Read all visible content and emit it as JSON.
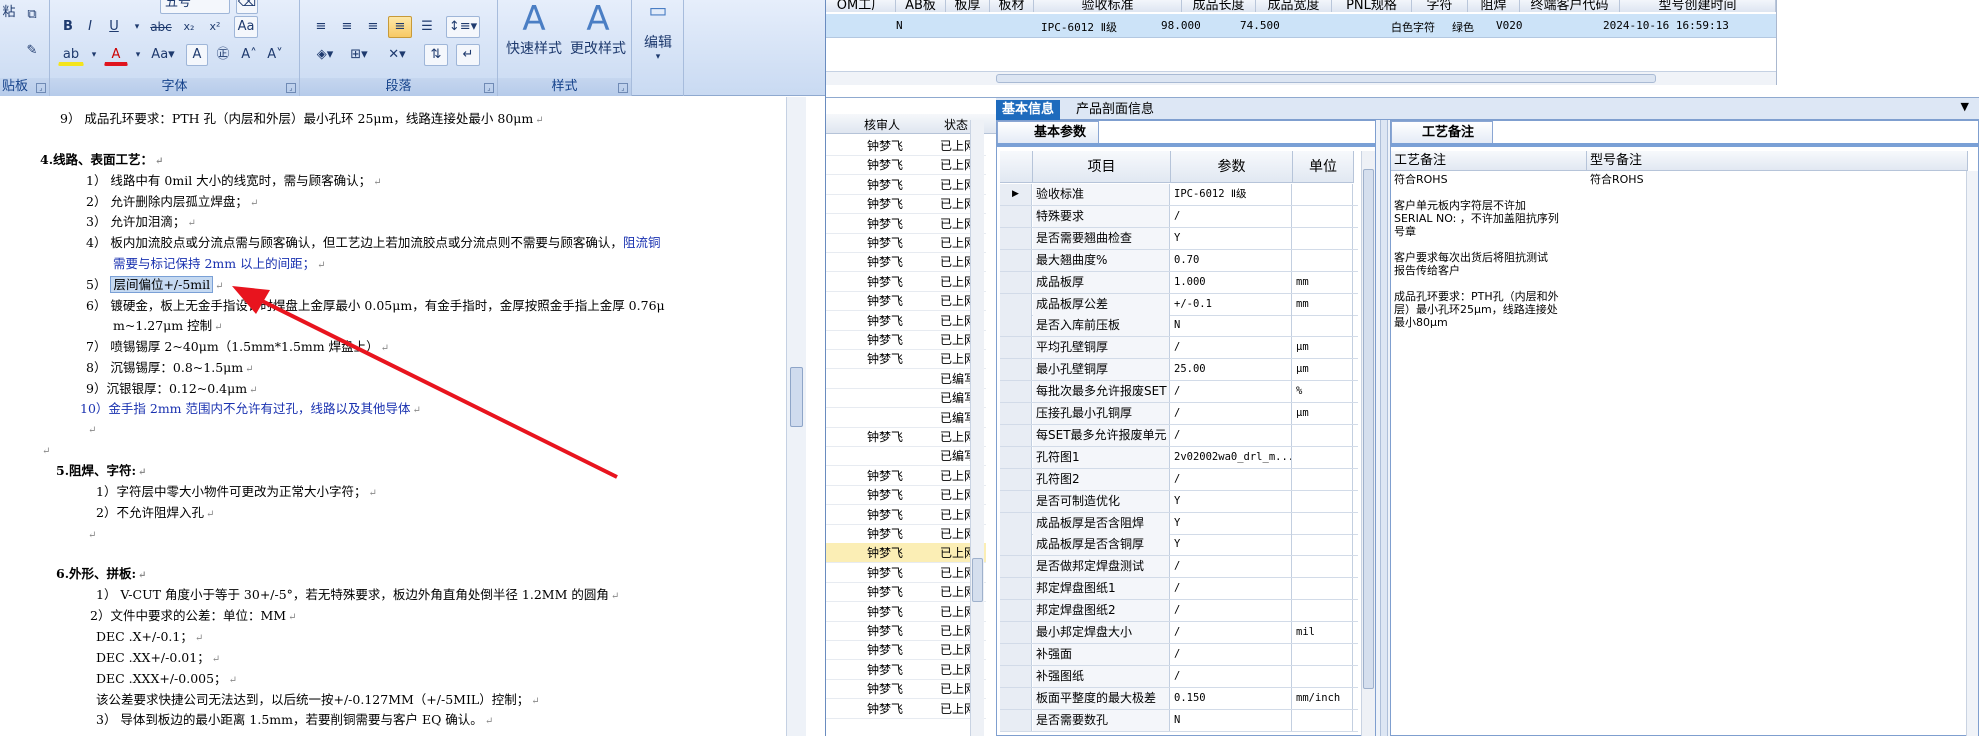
{
  "word": {
    "ribbon": {
      "font_group_label": "字体",
      "paragraph_group_label": "段落",
      "styles_group_label": "样式",
      "clipboard_label": "粘",
      "clipboard_group_label": "贴板",
      "font_size_value": "五号",
      "quick_styles_label": "快速样式",
      "change_styles_label": "更改样式",
      "edit_label": "编辑"
    },
    "lines": [
      "9） 成品孔环要求：PTH 孔（内层和外层）最小孔环 25μm，线路连接处最小 80μm",
      "4.线路、表面工艺：",
      "1） 线路中有 0mil 大小的线宽时，需与顾客确认；",
      "2） 允许删除内层孤立焊盘；",
      "3） 允许加泪滴；",
      "4） 板内加流胶点或分流点需与顾客确认，但工艺边上若加流胶点或分流点则不需要与顾客确认，",
      "阻流铜",
      "需要与标记保持 2mm 以上的间距；",
      "5）",
      "层间偏位+/-5mil",
      "6） 镀硬金，板上无金手指设计时焊盘上金厚最小 0.05μm，有金手指时，金厚按照金手指上金厚 0.76μ",
      "m~1.27μm 控制",
      "7） 喷锡锡厚 2~40μm（1.5mm*1.5mm 焊盘上）",
      "8） 沉锡锡厚：0.8~1.5μm",
      "9）沉银银厚：0.12~0.4μm",
      "10）金手指 2mm 范围内不允许有过孔，线路以及其他导体",
      "5.阻焊、字符:",
      "1）字符层中零大小物件可更改为正常大小字符；",
      "2）不允许阻焊入孔",
      "6.外形、拼板:",
      "1） V-CUT 角度小于等于 30+/-5°，若无特殊要求，板边外角直角处倒半径 1.2MM 的圆角",
      "2）文件中要求的公差：单位：MM",
      "DEC .X+/-0.1；",
      "DEC .XX+/-0.01；",
      "DEC .XXX+/-0.005；",
      "该公差要求快捷公司无法达到，以后统一按+/-0.127MM（+/-5MIL）控制；",
      "3） 导体到板边的最小距离 1.5mm，若要削铜需要与客户 EQ 确认。"
    ]
  },
  "topgrid": {
    "headers": [
      "OM工厂",
      "AB板",
      "板厚",
      "板材",
      "验收标准",
      "成品长度",
      "成品宽度",
      "PNL规格",
      "字符",
      "阻焊",
      "终端客户代码",
      "型号创建时间"
    ],
    "row": [
      "N",
      "IPC-6012 Ⅱ级",
      "98.000",
      "74.500",
      "白色字符",
      "绿色",
      "V020",
      "2024-10-16 16:59:13"
    ]
  },
  "midlist": {
    "headers": [
      "核审人",
      "状态"
    ],
    "rows": [
      [
        "钟梦飞",
        "已上网"
      ],
      [
        "钟梦飞",
        "已上网"
      ],
      [
        "钟梦飞",
        "已上网"
      ],
      [
        "钟梦飞",
        "已上网"
      ],
      [
        "钟梦飞",
        "已上网"
      ],
      [
        "钟梦飞",
        "已上网"
      ],
      [
        "钟梦飞",
        "已上网"
      ],
      [
        "钟梦飞",
        "已上网"
      ],
      [
        "钟梦飞",
        "已上网"
      ],
      [
        "钟梦飞",
        "已上网"
      ],
      [
        "钟梦飞",
        "已上网"
      ],
      [
        "钟梦飞",
        "已上网"
      ],
      [
        "",
        "已编写"
      ],
      [
        "",
        "已编写"
      ],
      [
        "",
        "已编写"
      ],
      [
        "钟梦飞",
        "已上网"
      ],
      [
        "",
        "已编写"
      ],
      [
        "钟梦飞",
        "已上网"
      ],
      [
        "钟梦飞",
        "已上网"
      ],
      [
        "钟梦飞",
        "已上网"
      ],
      [
        "钟梦飞",
        "已上网"
      ],
      [
        "钟梦飞",
        "已上网"
      ],
      [
        "钟梦飞",
        "已上网"
      ],
      [
        "钟梦飞",
        "已上网"
      ],
      [
        "钟梦飞",
        "已上网"
      ],
      [
        "钟梦飞",
        "已上网"
      ],
      [
        "钟梦飞",
        "已上网"
      ],
      [
        "钟梦飞",
        "已上网"
      ],
      [
        "钟梦飞",
        "已上网"
      ],
      [
        "钟梦飞",
        "已上网"
      ]
    ]
  },
  "info": {
    "tabs": [
      "基本信息",
      "产品剖面信息"
    ],
    "params_tab": "基本参数",
    "notes_tab": "工艺备注",
    "param_headers": [
      "项目",
      "参数",
      "单位"
    ],
    "params": [
      [
        "验收标准",
        "IPC-6012 Ⅱ级",
        ""
      ],
      [
        "特殊要求",
        "/",
        ""
      ],
      [
        "是否需要翘曲检查",
        "Y",
        ""
      ],
      [
        "最大翘曲度%",
        "0.70",
        ""
      ],
      [
        "成品板厚",
        "1.000",
        "mm"
      ],
      [
        "成品板厚公差",
        "+/-0.1",
        "mm"
      ],
      [
        "是否入库前压板",
        "N",
        ""
      ],
      [
        "平均孔壁铜厚",
        "/",
        "μm"
      ],
      [
        "最小孔壁铜厚",
        "25.00",
        "μm"
      ],
      [
        "每批次最多允许报废SET",
        "/",
        "%"
      ],
      [
        "压接孔最小孔铜厚",
        "/",
        "μm"
      ],
      [
        "每SET最多允许报废单元",
        "/",
        ""
      ],
      [
        "孔符图1",
        "2v02002wa0_drl_m...",
        ""
      ],
      [
        "孔符图2",
        "/",
        ""
      ],
      [
        "是否可制造优化",
        "Y",
        ""
      ],
      [
        "成品板厚是否含阻焊",
        "Y",
        ""
      ],
      [
        "成品板厚是否含铜厚",
        "Y",
        ""
      ],
      [
        "是否做邦定焊盘测试",
        "/",
        ""
      ],
      [
        "邦定焊盘图纸1",
        "/",
        ""
      ],
      [
        "邦定焊盘图纸2",
        "/",
        ""
      ],
      [
        "最小邦定焊盘大小",
        "/",
        "mil"
      ],
      [
        "补强面",
        "/",
        ""
      ],
      [
        "补强图纸",
        "/",
        ""
      ],
      [
        "板面平整度的最大极差",
        "0.150",
        "mm/inch"
      ],
      [
        "是否需要数孔",
        "N",
        ""
      ]
    ],
    "notes_headers": [
      "工艺备注",
      "型号备注"
    ],
    "notes_col1": "符合ROHS\n\n客户单元板内字符层不许加\nSERIAL NO: ，不许加盖阻抗序列\n号章\n\n客户要求每次出货后将阻抗测试\n报告传给客户\n\n成品孔环要求：PTH孔（内层和外\n层）最小孔环25μm，线路连接处\n最小80μm",
    "notes_col2": "符合ROHS"
  },
  "colors": {
    "arrow": "#e8141e",
    "selected_row": "#cce3f8",
    "tab_active": "#1e6bbd"
  }
}
